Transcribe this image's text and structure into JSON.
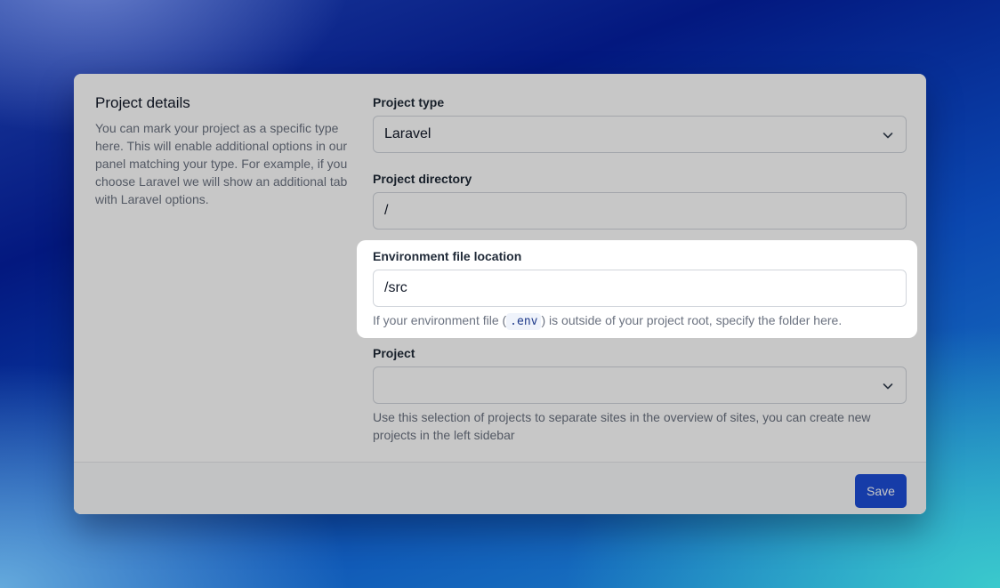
{
  "section": {
    "title": "Project details",
    "description": "You can mark your project as a specific type here. This will enable additional options in our panel matching your type. For example, if you choose Laravel we will show an additional tab with Laravel options."
  },
  "project_type": {
    "label": "Project type",
    "value": "Laravel"
  },
  "project_directory": {
    "label": "Project directory",
    "value": "/"
  },
  "env_location": {
    "label": "Environment file location",
    "value": "/src",
    "help_prefix": "If your environment file (",
    "help_code": ".env",
    "help_suffix": ") is outside of your project root, specify the folder here."
  },
  "project": {
    "label": "Project",
    "value": "",
    "help": "Use this selection of projects to separate sites in the overview of sites, you can create new projects in the left sidebar"
  },
  "footer": {
    "save_label": "Save"
  },
  "icons": {
    "select_chevron": "chevron-down-icon"
  },
  "colors": {
    "accent": "#1d4ed8",
    "highlight_background": "#ffffff"
  }
}
